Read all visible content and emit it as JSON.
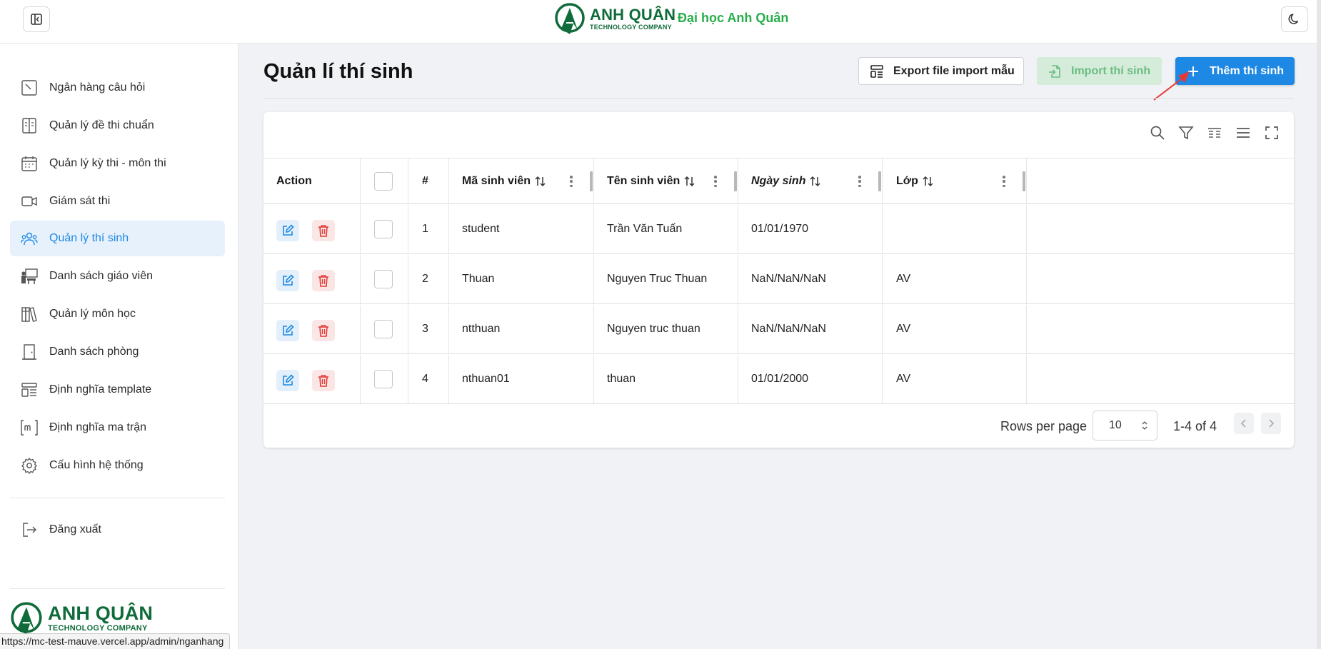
{
  "header": {
    "brand_name": "ANH QUÂN",
    "brand_sub": "TECHNOLOGY COMPANY",
    "university": "Đại học Anh Quân"
  },
  "sidebar": {
    "items": [
      {
        "label": "Ngân hàng câu hỏi",
        "icon": "question-bank-icon"
      },
      {
        "label": "Quản lý đề thi chuẩn",
        "icon": "book-open-icon"
      },
      {
        "label": "Quản lý kỳ thi - môn thi",
        "icon": "calendar-icon"
      },
      {
        "label": "Giám sát thi",
        "icon": "video-camera-icon"
      },
      {
        "label": "Quản lý thí sinh",
        "icon": "users-icon",
        "active": true
      },
      {
        "label": "Danh sách giáo viên",
        "icon": "teacher-icon"
      },
      {
        "label": "Quản lý môn học",
        "icon": "books-icon"
      },
      {
        "label": "Danh sách phòng",
        "icon": "door-icon"
      },
      {
        "label": "Định nghĩa template",
        "icon": "template-icon"
      },
      {
        "label": "Định nghĩa ma trận",
        "icon": "matrix-icon"
      },
      {
        "label": "Cấu hình hệ thống",
        "icon": "gear-icon"
      }
    ],
    "logout": {
      "label": "Đăng xuất",
      "icon": "logout-icon"
    },
    "logo_name": "ANH QUÂN",
    "logo_sub": "TECHNOLOGY COMPANY"
  },
  "status_url": "https://mc-test-mauve.vercel.app/admin/nganhang",
  "page": {
    "title": "Quản lí thí sinh",
    "export_label": "Export file import mẫu",
    "import_label": "Import thí sinh",
    "add_label": "Thêm thí sinh"
  },
  "table": {
    "columns": {
      "action": "Action",
      "index": "#",
      "student_id": "Mã sinh viên",
      "student_name": "Tên sinh viên",
      "dob": "Ngày sinh",
      "class": "Lớp"
    },
    "rows": [
      {
        "index": "1",
        "student_id": "student",
        "student_name": "Trần Văn Tuấn",
        "dob": "01/01/1970",
        "class": ""
      },
      {
        "index": "2",
        "student_id": "Thuan",
        "student_name": "Nguyen Truc Thuan",
        "dob": "NaN/NaN/NaN",
        "class": "AV"
      },
      {
        "index": "3",
        "student_id": "ntthuan",
        "student_name": "Nguyen truc thuan",
        "dob": "NaN/NaN/NaN",
        "class": "AV"
      },
      {
        "index": "4",
        "student_id": "nthuan01",
        "student_name": "thuan",
        "dob": "01/01/2000",
        "class": "AV"
      }
    ],
    "pagination": {
      "rows_per_page_label": "Rows per page",
      "rows_per_page": "10",
      "range": "1-4 of 4"
    }
  },
  "colors": {
    "accent": "#1e88e5",
    "brand_green": "#0f6b3a",
    "university_green": "#27ae4a",
    "active_bg": "#e6f1fb",
    "delete_red": "#e53935"
  }
}
